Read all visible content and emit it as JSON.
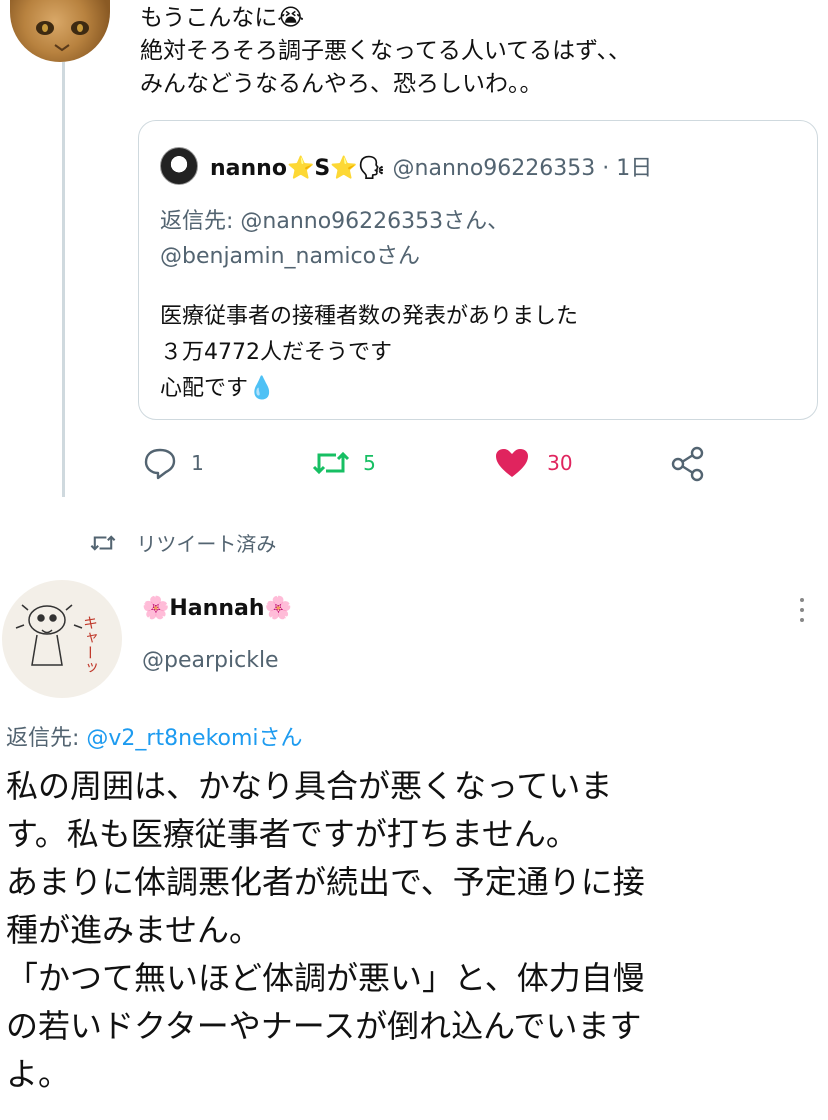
{
  "tweet_top": {
    "lines": [
      "もうこんなに😭",
      "絶対そろそろ調子悪くなってる人いてるはず、、",
      "みんなどうなるんやろ、恐ろしいわ。。"
    ]
  },
  "quote": {
    "name_text": "nanno",
    "name_emojis": "⭐S⭐🗣",
    "handle": "@nanno96226353",
    "time": "· 1日",
    "reply_prefix": "返信先: ",
    "reply_handle1": "@nanno96226353さん、",
    "reply_handle2": "@benjamin_namicoさん",
    "body": [
      "医療従事者の接種者数の発表がありました",
      "３万4772人だそうです",
      "心配です💧"
    ]
  },
  "actions": {
    "reply_count": "1",
    "retweet_count": "5",
    "like_count": "30",
    "colors": {
      "retweet": "#17bf63",
      "like": "#e0245e",
      "neutral": "#536471"
    }
  },
  "retweeted_label": "リツイート済み",
  "tweet_hannah": {
    "name": "🌸Hannah🌸",
    "handle": "@pearpickle",
    "avatar_text": "キャーッ",
    "reply_label": "返信先: ",
    "reply_handle": "@v2_rt8nekomiさん",
    "body": [
      "私の周囲は、かなり具合が悪くなっていま",
      "す。私も医療従事者ですが打ちません。",
      "あまりに体調悪化者が続出で、予定通りに接",
      "種が進みません。",
      "「かつて無いほど体調が悪い」と、体力自慢",
      "の若いドクターやナースが倒れ込んでいます",
      "よ。"
    ]
  }
}
